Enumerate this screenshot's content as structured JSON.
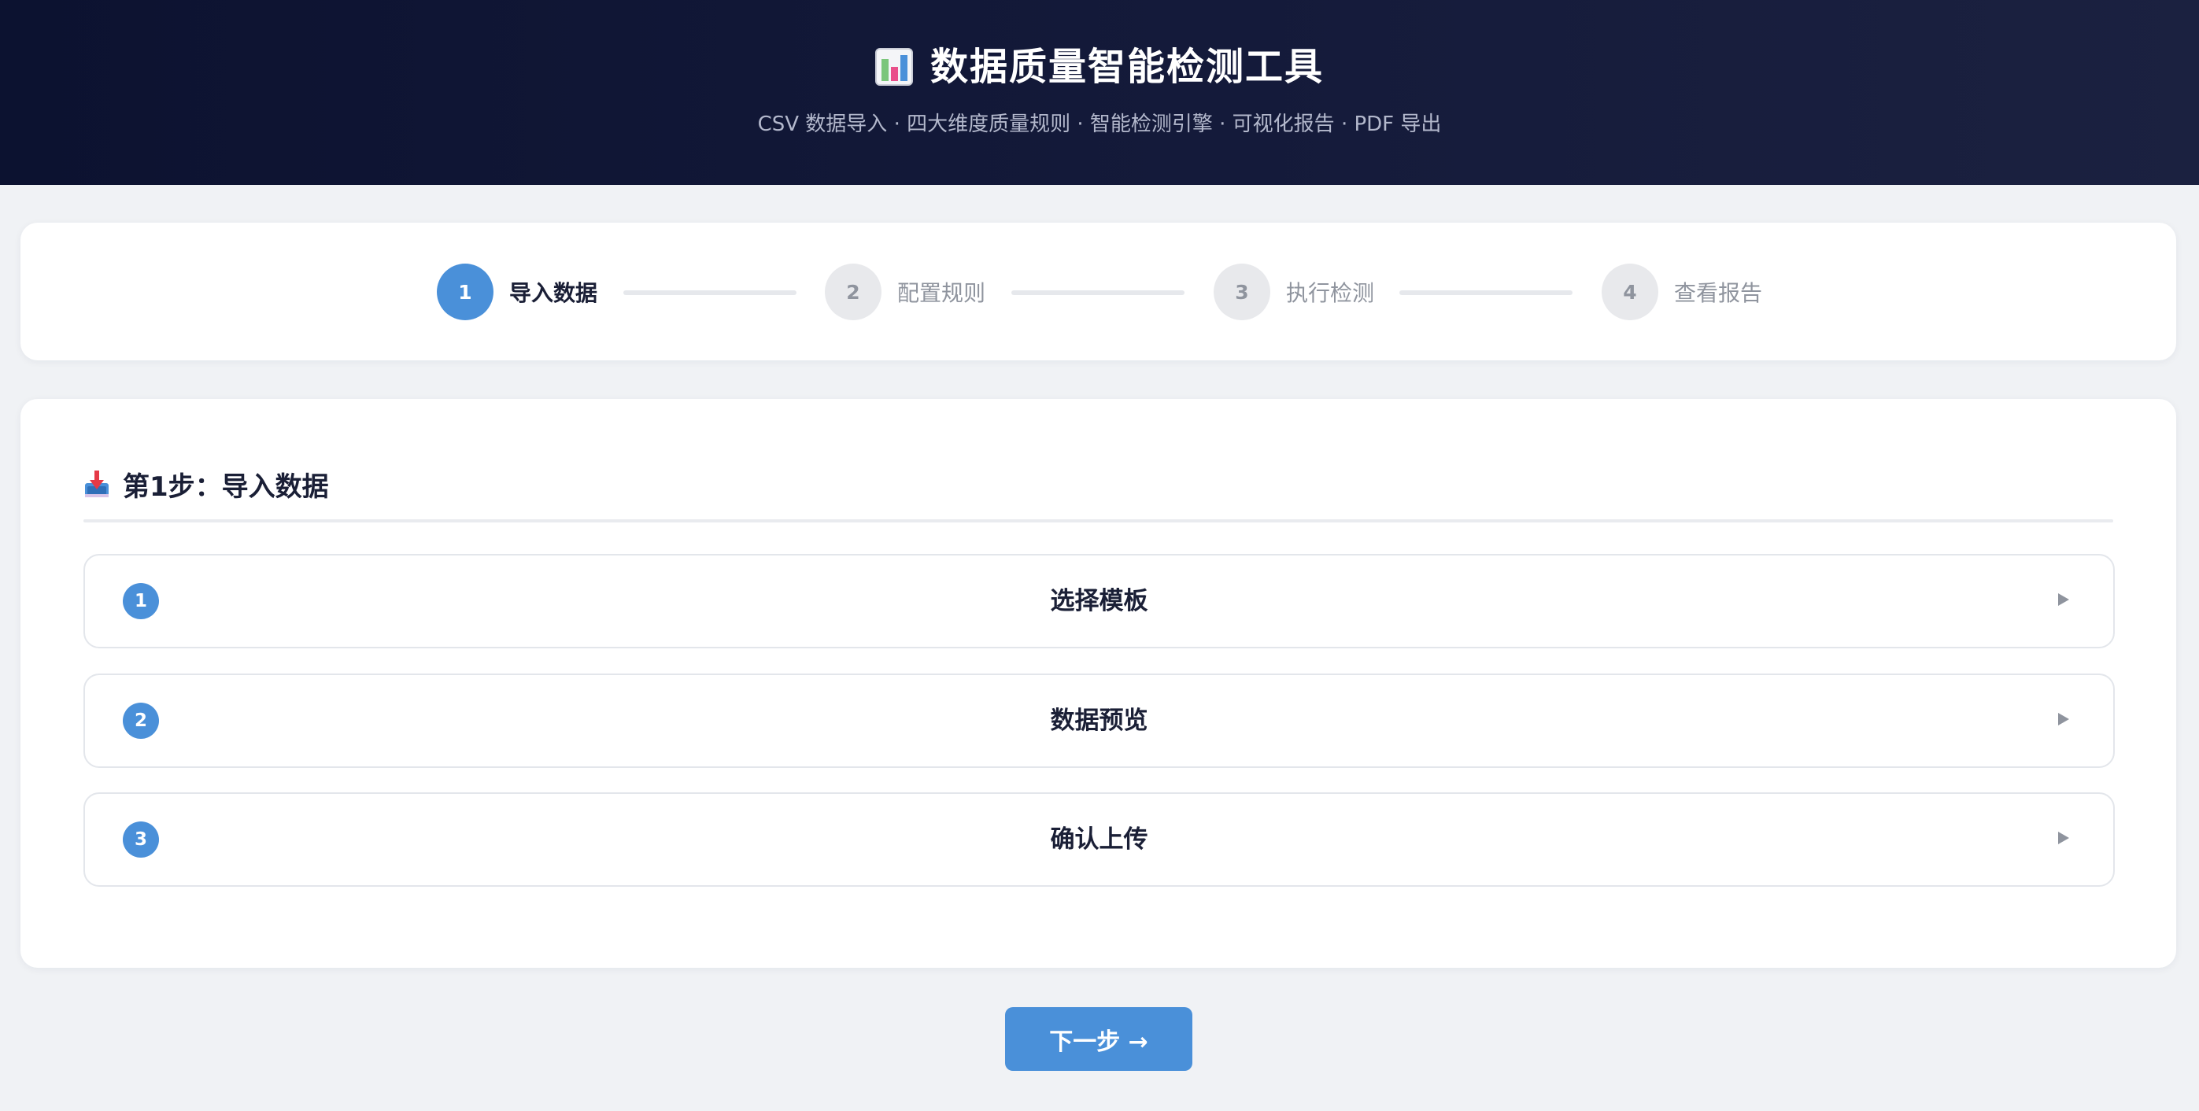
{
  "header": {
    "title": "数据质量智能检测工具",
    "subtitle": "CSV 数据导入 · 四大维度质量规则 · 智能检测引擎 · 可视化报告 · PDF 导出",
    "icon": "bar-chart-icon"
  },
  "stepper": {
    "steps": [
      {
        "number": "1",
        "label": "导入数据",
        "state": "active"
      },
      {
        "number": "2",
        "label": "配置规则",
        "state": "pending"
      },
      {
        "number": "3",
        "label": "执行检测",
        "state": "pending"
      },
      {
        "number": "4",
        "label": "查看报告",
        "state": "pending"
      }
    ]
  },
  "section": {
    "title": "第1步：导入数据",
    "icon": "inbox-tray-icon",
    "items": [
      {
        "number": "1",
        "title": "选择模板",
        "arrow": "expand-arrow-icon"
      },
      {
        "number": "2",
        "title": "数据预览",
        "arrow": "expand-arrow-icon"
      },
      {
        "number": "3",
        "title": "确认上传",
        "arrow": "expand-arrow-icon"
      }
    ]
  },
  "next_button": {
    "label": "下一步 →"
  },
  "colors": {
    "accent": "#4a90d9",
    "header_bg": "#0c1230",
    "page_bg": "#f0f2f5",
    "pending_step": "#e8e9ec"
  }
}
